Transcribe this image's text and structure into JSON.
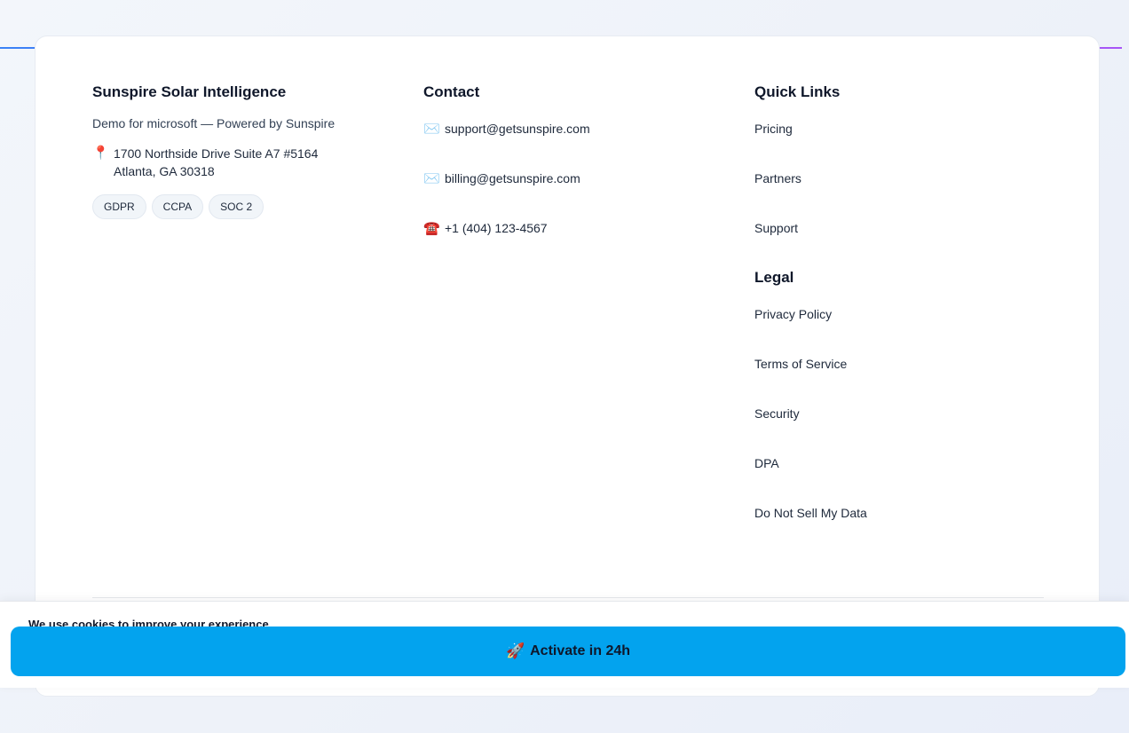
{
  "brand": {
    "title": "Sunspire Solar Intelligence",
    "tagline": "Demo for microsoft — Powered by Sunspire",
    "address_line1": "1700 Northside Drive Suite A7 #5164",
    "address_line2": "Atlanta, GA 30318",
    "pin_icon": "📍",
    "badges": [
      "GDPR",
      "CCPA",
      "SOC 2"
    ]
  },
  "contact": {
    "heading": "Contact",
    "items": [
      {
        "icon": "✉️",
        "label": "support@getsunspire.com"
      },
      {
        "icon": "✉️",
        "label": "billing@getsunspire.com"
      },
      {
        "icon": "☎️",
        "label": "+1 (404) 123-4567"
      }
    ]
  },
  "quick_links": {
    "heading": "Quick Links",
    "items": [
      "Pricing",
      "Partners",
      "Support"
    ]
  },
  "legal": {
    "heading": "Legal",
    "items": [
      "Privacy Policy",
      "Terms of Service",
      "Security",
      "DPA",
      "Do Not Sell My Data"
    ]
  },
  "cookie_bar": {
    "text": "We use cookies to improve your experience.",
    "button_icon": "🚀",
    "button_label": "Activate in 24h"
  },
  "colors": {
    "accent_button": "#03a3ee",
    "gradient_start": "#3b82f6",
    "gradient_end": "#a855f7"
  }
}
